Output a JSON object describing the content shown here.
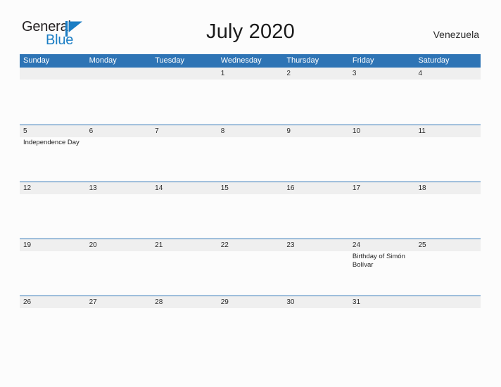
{
  "brand": {
    "name_part1": "General",
    "name_part2": "Blue",
    "flag_icon": "blue-flag-icon",
    "colors": {
      "dark": "#231f20",
      "blue": "#1a7dc4"
    }
  },
  "header": {
    "title": "July 2020",
    "country": "Venezuela"
  },
  "theme": {
    "header_blue": "#2e74b5",
    "band_gray": "#efefef",
    "page_background": "#fcfcfc",
    "text_dark": "#1f1f1f"
  },
  "calendar": {
    "day_names": [
      "Sunday",
      "Monday",
      "Tuesday",
      "Wednesday",
      "Thursday",
      "Friday",
      "Saturday"
    ],
    "weeks": [
      {
        "days": [
          {
            "number": "",
            "events": []
          },
          {
            "number": "",
            "events": []
          },
          {
            "number": "",
            "events": []
          },
          {
            "number": "1",
            "events": []
          },
          {
            "number": "2",
            "events": []
          },
          {
            "number": "3",
            "events": []
          },
          {
            "number": "4",
            "events": []
          }
        ]
      },
      {
        "days": [
          {
            "number": "5",
            "events": [
              "Independence Day"
            ]
          },
          {
            "number": "6",
            "events": []
          },
          {
            "number": "7",
            "events": []
          },
          {
            "number": "8",
            "events": []
          },
          {
            "number": "9",
            "events": []
          },
          {
            "number": "10",
            "events": []
          },
          {
            "number": "11",
            "events": []
          }
        ]
      },
      {
        "days": [
          {
            "number": "12",
            "events": []
          },
          {
            "number": "13",
            "events": []
          },
          {
            "number": "14",
            "events": []
          },
          {
            "number": "15",
            "events": []
          },
          {
            "number": "16",
            "events": []
          },
          {
            "number": "17",
            "events": []
          },
          {
            "number": "18",
            "events": []
          }
        ]
      },
      {
        "days": [
          {
            "number": "19",
            "events": []
          },
          {
            "number": "20",
            "events": []
          },
          {
            "number": "21",
            "events": []
          },
          {
            "number": "22",
            "events": []
          },
          {
            "number": "23",
            "events": []
          },
          {
            "number": "24",
            "events": [
              "Birthday of Simón Bolívar"
            ]
          },
          {
            "number": "25",
            "events": []
          }
        ]
      },
      {
        "days": [
          {
            "number": "26",
            "events": []
          },
          {
            "number": "27",
            "events": []
          },
          {
            "number": "28",
            "events": []
          },
          {
            "number": "29",
            "events": []
          },
          {
            "number": "30",
            "events": []
          },
          {
            "number": "31",
            "events": []
          },
          {
            "number": "",
            "events": []
          }
        ]
      }
    ]
  }
}
